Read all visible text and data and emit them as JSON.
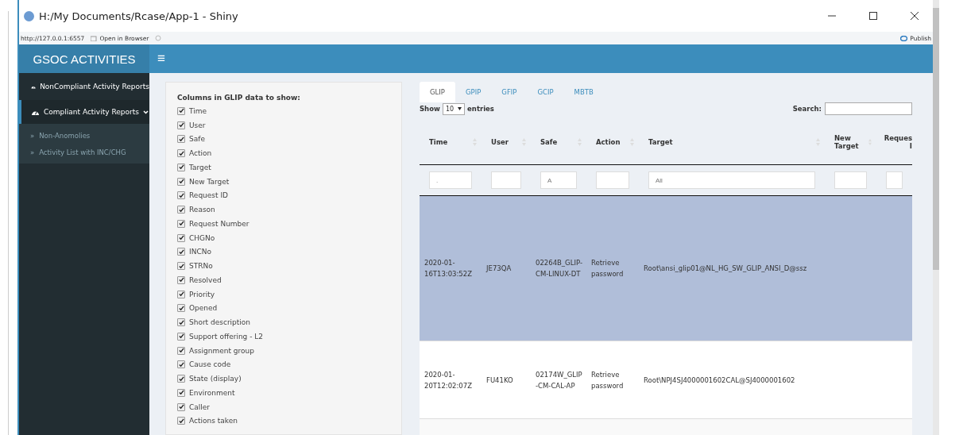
{
  "window": {
    "title": "H:/My Documents/Rcase/App-1 - Shiny"
  },
  "address_bar": {
    "url": "http://127.0.0.1:6557",
    "open_in_browser": "Open in Browser",
    "publish": "Publish"
  },
  "header": {
    "title": "GSOC ACTIVITIES",
    "menu_icon": "≡"
  },
  "sidebar": {
    "items": [
      {
        "label": "NonCompliant Activity Reports",
        "expanded": false
      },
      {
        "label": "Compliant Activity Reports",
        "expanded": true,
        "children": [
          {
            "marker": "»",
            "label": "Non-Anomolies"
          },
          {
            "marker": "»",
            "label": "Activity List with INC/CHG"
          }
        ]
      }
    ]
  },
  "column_panel": {
    "title": "Columns in GLIP data to show:",
    "options": [
      {
        "label": "Time",
        "checked": true
      },
      {
        "label": "User",
        "checked": true
      },
      {
        "label": "Safe",
        "checked": true
      },
      {
        "label": "Action",
        "checked": true
      },
      {
        "label": "Target",
        "checked": true
      },
      {
        "label": "New Target",
        "checked": true
      },
      {
        "label": "Request ID",
        "checked": true
      },
      {
        "label": "Reason",
        "checked": true
      },
      {
        "label": "Request Number",
        "checked": true
      },
      {
        "label": "CHGNo",
        "checked": true
      },
      {
        "label": "INCNo",
        "checked": true
      },
      {
        "label": "STRNo",
        "checked": true
      },
      {
        "label": "Resolved",
        "checked": true
      },
      {
        "label": "Priority",
        "checked": true
      },
      {
        "label": "Opened",
        "checked": true
      },
      {
        "label": "Short description",
        "checked": true
      },
      {
        "label": "Support offering - L2",
        "checked": true
      },
      {
        "label": "Assignment group",
        "checked": true
      },
      {
        "label": "Cause code",
        "checked": true
      },
      {
        "label": "State (display)",
        "checked": true
      },
      {
        "label": "Environment",
        "checked": true
      },
      {
        "label": "Caller",
        "checked": true
      },
      {
        "label": "Actions taken",
        "checked": true
      }
    ]
  },
  "tabs": [
    {
      "label": "GLIP",
      "selected": true
    },
    {
      "label": "GPIP",
      "selected": false
    },
    {
      "label": "GFIP",
      "selected": false
    },
    {
      "label": "GCIP",
      "selected": false
    },
    {
      "label": "MBTB",
      "selected": false
    }
  ],
  "length_control": {
    "show": "Show",
    "value": "10",
    "entries": "entries"
  },
  "search": {
    "label": "Search:"
  },
  "table": {
    "columns": [
      {
        "label": "Time",
        "placeholder": "."
      },
      {
        "label": "User"
      },
      {
        "label": "Safe",
        "placeholder": "A"
      },
      {
        "label": "Action"
      },
      {
        "label": "Target",
        "placeholder": "All"
      },
      {
        "label": "New Target"
      },
      {
        "label": "Reques I"
      }
    ],
    "rows": [
      {
        "selected": true,
        "cells": [
          "2020-01-16T13:03:52Z",
          "JE73QA",
          "02264B_GLIP-CM-LINUX-DT",
          "Retrieve password",
          "Root\\ansi_glip01@NL_HG_SW_GLIP_ANSI_D@ssz"
        ]
      },
      {
        "selected": false,
        "cells": [
          "2020-01-20T12:02:07Z",
          "FU41KO",
          "02174W_GLIP-CM-CAL-AP",
          "Retrieve password",
          "Root\\NPJ4SJ4000001602CAL@SJ4000001602"
        ]
      }
    ]
  }
}
